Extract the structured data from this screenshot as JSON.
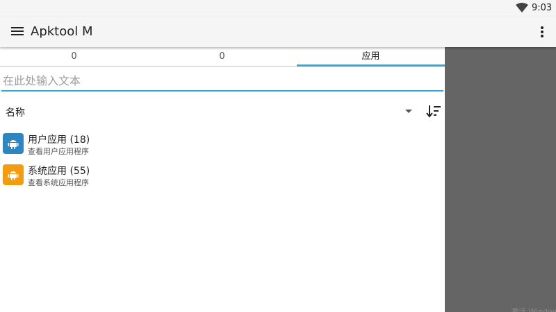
{
  "status_bar": {
    "time": "9:03",
    "wifi_icon": "wifi-icon"
  },
  "app_bar": {
    "title": "Apktool M",
    "menu_icon": "hamburger-menu-icon",
    "overflow_icon": "more-vert-icon"
  },
  "tabs": [
    {
      "label": "0",
      "active": false
    },
    {
      "label": "0",
      "active": false
    },
    {
      "label": "应用",
      "active": true
    }
  ],
  "search": {
    "placeholder": "在此处输入文本",
    "value": ""
  },
  "sort": {
    "label": "名称",
    "dropdown_icon": "dropdown-arrow-icon",
    "order_icon": "sort-order-icon"
  },
  "items": [
    {
      "title": "用户应用 (18)",
      "subtitle": "查看用户应用程序",
      "icon": "android-icon",
      "color": "#2e86c1"
    },
    {
      "title": "系统应用 (55)",
      "subtitle": "查看系统应用程序",
      "icon": "android-icon",
      "color": "#f39c12"
    }
  ],
  "watermark": "激活 Windows",
  "colors": {
    "accent": "#29a9dc",
    "side_panel": "#656565",
    "user_app": "#2e86c1",
    "system_app": "#f39c12"
  }
}
